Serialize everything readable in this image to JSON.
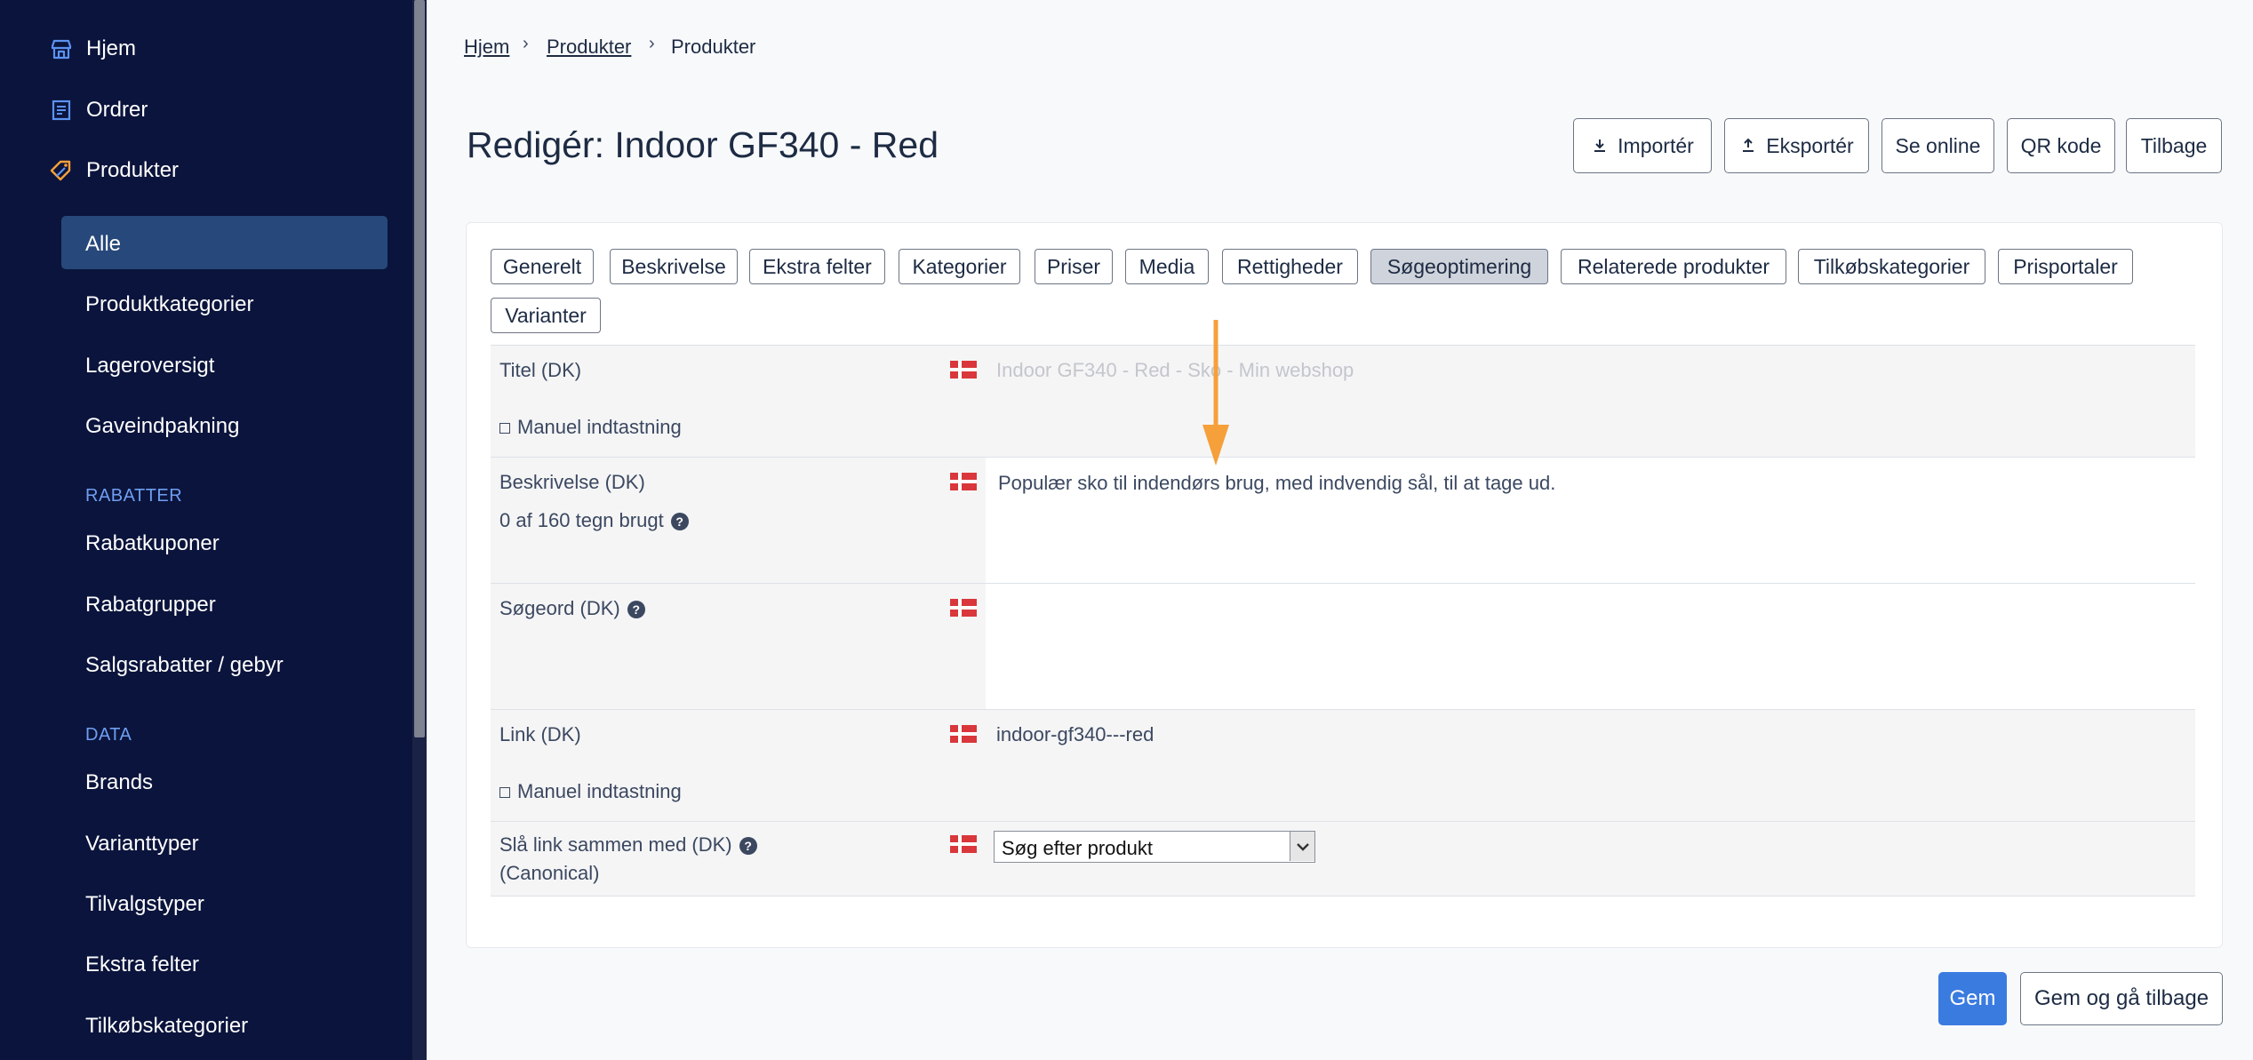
{
  "sidebar": {
    "main_items": [
      {
        "label": "Hjem",
        "icon": "store-icon"
      },
      {
        "label": "Ordrer",
        "icon": "receipt-icon"
      },
      {
        "label": "Produkter",
        "icon": "tag-icon"
      }
    ],
    "sub_items": [
      "Alle",
      "Produktkategorier",
      "Lageroversigt",
      "Gaveindpakning"
    ],
    "active_item": "Alle",
    "sections": [
      {
        "heading": "RABATTER",
        "items": [
          "Rabatkuponer",
          "Rabatgrupper",
          "Salgsrabatter / gebyr"
        ]
      },
      {
        "heading": "DATA",
        "items": [
          "Brands",
          "Varianttyper",
          "Tilvalgstyper",
          "Ekstra felter",
          "Tilkøbskategorier"
        ]
      }
    ]
  },
  "breadcrumb": [
    "Hjem",
    "Produkter",
    "Produkter"
  ],
  "page_title": "Redigér: Indoor GF340 - Red",
  "header_buttons": [
    "Importér",
    "Eksportér",
    "Se online",
    "QR kode",
    "Tilbage"
  ],
  "tabs": [
    "Generelt",
    "Beskrivelse",
    "Ekstra felter",
    "Kategorier",
    "Priser",
    "Media",
    "Rettigheder",
    "Søgeoptimering",
    "Relaterede produkter",
    "Tilkøbskategorier",
    "Prisportaler",
    "Varianter"
  ],
  "active_tab": "Søgeoptimering",
  "fields": {
    "title": {
      "label": "Titel (DK)",
      "manual": "Manuel indtastning",
      "placeholder": "Indoor GF340 - Red - Sko - Min webshop"
    },
    "description": {
      "label": "Beskrivelse (DK)",
      "counter": "0 af 160 tegn brugt",
      "placeholder": "Populær sko til indendørs brug, med indvendig sål, til at tage ud."
    },
    "keywords": {
      "label": "Søgeord (DK)",
      "value": ""
    },
    "link": {
      "label": "Link (DK)",
      "manual": "Manuel indtastning",
      "value": "indoor-gf340---red"
    },
    "canonical": {
      "label": "Slå link sammen med (DK)",
      "sublabel": "(Canonical)",
      "selected": "Søg efter produkt"
    }
  },
  "footer_buttons": {
    "save": "Gem",
    "save_back": "Gem og gå tilbage"
  },
  "colors": {
    "sidebar_bg": "#0b143c",
    "active_bg": "#27487a",
    "accent": "#3a7be0",
    "annotation_arrow": "#f5a03a",
    "section_heading": "#6f9ff2"
  }
}
